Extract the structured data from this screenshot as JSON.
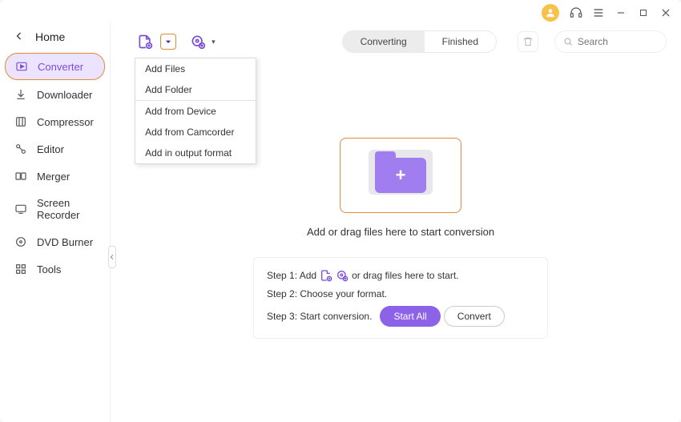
{
  "titlebar": {
    "avatar_initial": ""
  },
  "sidebar": {
    "home": "Home",
    "items": [
      {
        "label": "Converter"
      },
      {
        "label": "Downloader"
      },
      {
        "label": "Compressor"
      },
      {
        "label": "Editor"
      },
      {
        "label": "Merger"
      },
      {
        "label": "Screen Recorder"
      },
      {
        "label": "DVD Burner"
      },
      {
        "label": "Tools"
      }
    ]
  },
  "topbar": {
    "tabs": {
      "left": "Converting",
      "right": "Finished"
    },
    "search_placeholder": "Search"
  },
  "dropdown": {
    "items": [
      "Add Files",
      "Add Folder",
      "Add from Device",
      "Add from Camcorder",
      "Add in output format"
    ]
  },
  "drop": {
    "label": "Add or drag files here to start conversion"
  },
  "steps": {
    "s1a": "Step 1: Add",
    "s1b": "or drag files here to start.",
    "s2": "Step 2: Choose your format.",
    "s3": "Step 3: Start conversion.",
    "start_all": "Start All",
    "convert": "Convert"
  }
}
